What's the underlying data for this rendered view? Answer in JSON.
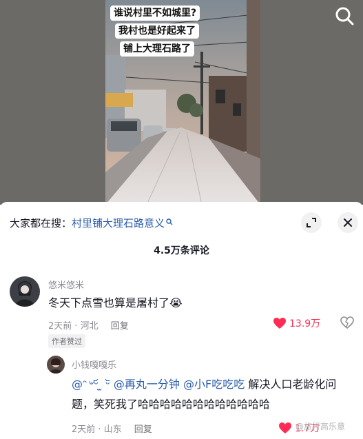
{
  "video": {
    "caption_lines": [
      "谁说村里不如城里?",
      "我村也是好起来了",
      "铺上大理石路了"
    ],
    "search_icon": "search-icon"
  },
  "hot_search": {
    "label": "大家都在搜：",
    "keyword": "村里铺大理石路意义",
    "icon": "search-icon"
  },
  "header_icons": {
    "expand": "expand-icon",
    "close": "close-icon"
  },
  "comment_count": "4.5万条评论",
  "comments": [
    {
      "username": "悠米悠米",
      "text": "冬天下点雪也算是屠村了",
      "emoji": "😭",
      "time": "2天前",
      "location": "河北",
      "reply_label": "回复",
      "likes": "13.9万",
      "liked": true,
      "tag": "作者赞过"
    },
    {
      "username": "小钱嘎嘎乐",
      "mentions": [
        "@ᵔ৺ᵕ᷄ ̫ ᵕ᷅",
        "@再丸一分钟",
        "@小F吃吃吃"
      ],
      "text_after": "解决人口老龄化问题，笑死我了哈哈哈哈哈哈哈哈哈哈哈哈",
      "time": "2天前",
      "location": "山东",
      "reply_label": "回复",
      "likes": "1.7万",
      "liked": true
    }
  ],
  "watermark": "@旅行高乐意",
  "colors": {
    "accent": "#fe2c55",
    "link": "#2a5caa",
    "muted": "#8a8b91"
  }
}
